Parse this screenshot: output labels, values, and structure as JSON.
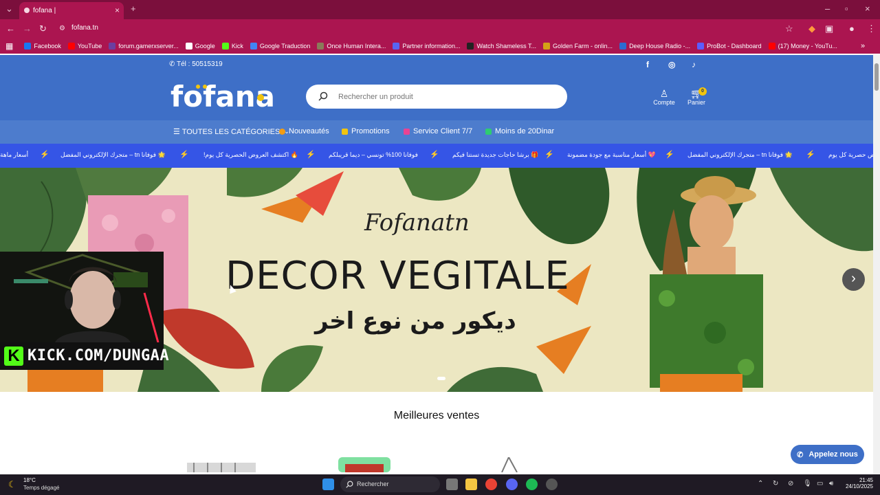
{
  "browser": {
    "tab_title": "fofana |",
    "url": "fofana.tn",
    "bookmarks": [
      {
        "label": "Facebook",
        "color": "#1877f2"
      },
      {
        "label": "YouTube",
        "color": "#ff0000"
      },
      {
        "label": "forum.gamerxserver...",
        "color": "#6b3fa0"
      },
      {
        "label": "Google",
        "color": "#ffffff"
      },
      {
        "label": "Kick",
        "color": "#53fc18"
      },
      {
        "label": "Google Traduction",
        "color": "#4285f4"
      },
      {
        "label": "Once Human Intera...",
        "color": "#8a7a5a"
      },
      {
        "label": "Partner information...",
        "color": "#5865f2"
      },
      {
        "label": "Watch Shameless T...",
        "color": "#222222"
      },
      {
        "label": "Golden Farm - onlin...",
        "color": "#d4a017"
      },
      {
        "label": "Deep House Radio -...",
        "color": "#2d6bd1"
      },
      {
        "label": "ProBot - Dashboard",
        "color": "#5c5cff"
      },
      {
        "label": "(17) Money - YouTu...",
        "color": "#ff0000"
      }
    ]
  },
  "site": {
    "phone": "Tél : 50515319",
    "logo_text": "fofana",
    "search_placeholder": "Rechercher un produit",
    "account_label": "Compte",
    "cart_label": "Panier",
    "cart_count": "0",
    "categories": [
      {
        "label": "☰ TOUTES LES CATÉGORIES",
        "color": ""
      },
      {
        "label": "Nouveautés",
        "color": "#f39c12"
      },
      {
        "label": "Promotions",
        "color": "#f1c40f"
      },
      {
        "label": "Service Client 7/7",
        "color": "#e84393"
      },
      {
        "label": "Moins de 20Dinar",
        "color": "#2ecc71"
      }
    ],
    "ticker": [
      "أسعار ماهة",
      "🌟 فوفانا tn – متجرك الإلكتروني المفضل",
      "🔥 اكتشف العروض الحصرية كل يوم!",
      "فوفانا 100% تونسي – ديما قريبلكم",
      "🎁 برشا حاجات جديدة تستنا فيكم",
      "💖 أسعار مناسبة مع جودة مضمونة",
      "🌟 فوفانا tn – متجرك الإلكتروني المفضل",
      "🔥 عروض حصرية كل يوم"
    ],
    "hero": {
      "brand": "Fofanatn",
      "title": "DECOR VEGITALE",
      "subtitle_ar": "ديكور من نوع اخر"
    },
    "section_title": "Meilleures ventes",
    "call_button": "Appelez nous"
  },
  "overlay": {
    "stream_label": "KICK.COM/DUNGAA",
    "kick_letter": "K"
  },
  "taskbar": {
    "weather_temp": "18°C",
    "weather_desc": "Temps dégagé",
    "search_label": "Rechercher",
    "time": "21:45",
    "date": "24/10/2025"
  }
}
